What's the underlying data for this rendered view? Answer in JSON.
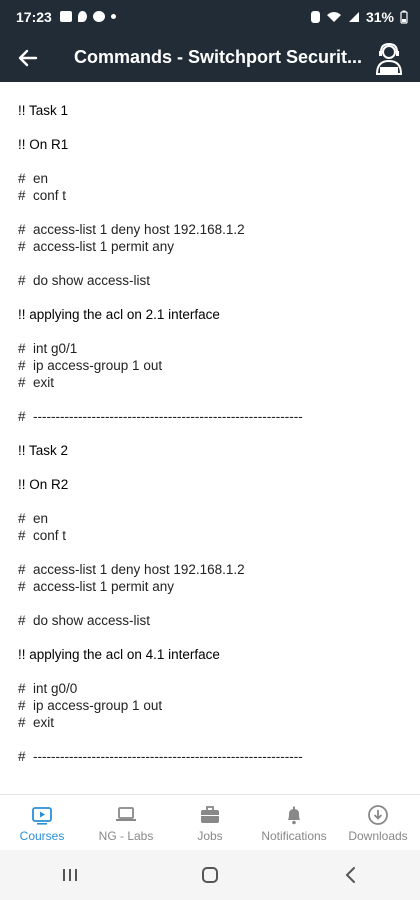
{
  "status_bar": {
    "time": "17:23",
    "battery": "31%"
  },
  "app_bar": {
    "title": "Commands - Switchport Securit..."
  },
  "content": {
    "lines": [
      {
        "type": "heading",
        "text": "!! Task 1"
      },
      {
        "type": "gap"
      },
      {
        "type": "heading",
        "text": "!! On R1"
      },
      {
        "type": "gap"
      },
      {
        "type": "cmd",
        "text": "#  en"
      },
      {
        "type": "cmd",
        "text": "#  conf t"
      },
      {
        "type": "gap"
      },
      {
        "type": "cmd",
        "text": "#  access-list 1 deny host 192.168.1.2"
      },
      {
        "type": "cmd",
        "text": "#  access-list 1 permit any"
      },
      {
        "type": "gap"
      },
      {
        "type": "cmd",
        "text": "#  do show access-list"
      },
      {
        "type": "gap"
      },
      {
        "type": "heading",
        "text": "!! applying the acl on 2.1 interface"
      },
      {
        "type": "gap"
      },
      {
        "type": "cmd",
        "text": "#  int g0/1"
      },
      {
        "type": "cmd",
        "text": "#  ip access-group 1 out"
      },
      {
        "type": "cmd",
        "text": "#  exit"
      },
      {
        "type": "gap"
      },
      {
        "type": "cmd",
        "text": "#  ------------------------------------------------------------"
      },
      {
        "type": "gap"
      },
      {
        "type": "heading",
        "text": "!! Task 2"
      },
      {
        "type": "gap"
      },
      {
        "type": "heading",
        "text": "!! On R2"
      },
      {
        "type": "gap"
      },
      {
        "type": "cmd",
        "text": "#  en"
      },
      {
        "type": "cmd",
        "text": "#  conf t"
      },
      {
        "type": "gap"
      },
      {
        "type": "cmd",
        "text": "#  access-list 1 deny host 192.168.1.2"
      },
      {
        "type": "cmd",
        "text": "#  access-list 1 permit any"
      },
      {
        "type": "gap"
      },
      {
        "type": "cmd",
        "text": "#  do show access-list"
      },
      {
        "type": "gap"
      },
      {
        "type": "heading",
        "text": "!! applying the acl on 4.1 interface"
      },
      {
        "type": "gap"
      },
      {
        "type": "cmd",
        "text": "#  int g0/0"
      },
      {
        "type": "cmd",
        "text": "#  ip access-group 1 out"
      },
      {
        "type": "cmd",
        "text": "#  exit"
      },
      {
        "type": "gap"
      },
      {
        "type": "cmd",
        "text": "#  ------------------------------------------------------------"
      }
    ]
  },
  "bottom_nav": {
    "items": [
      {
        "label": "Courses",
        "icon": "play-icon",
        "active": true
      },
      {
        "label": "NG - Labs",
        "icon": "laptop-icon",
        "active": false
      },
      {
        "label": "Jobs",
        "icon": "briefcase-icon",
        "active": false
      },
      {
        "label": "Notifications",
        "icon": "bell-icon",
        "active": false
      },
      {
        "label": "Downloads",
        "icon": "download-icon",
        "active": false
      }
    ]
  },
  "colors": {
    "header_bg": "#222c36",
    "accent": "#2a8fd6"
  }
}
